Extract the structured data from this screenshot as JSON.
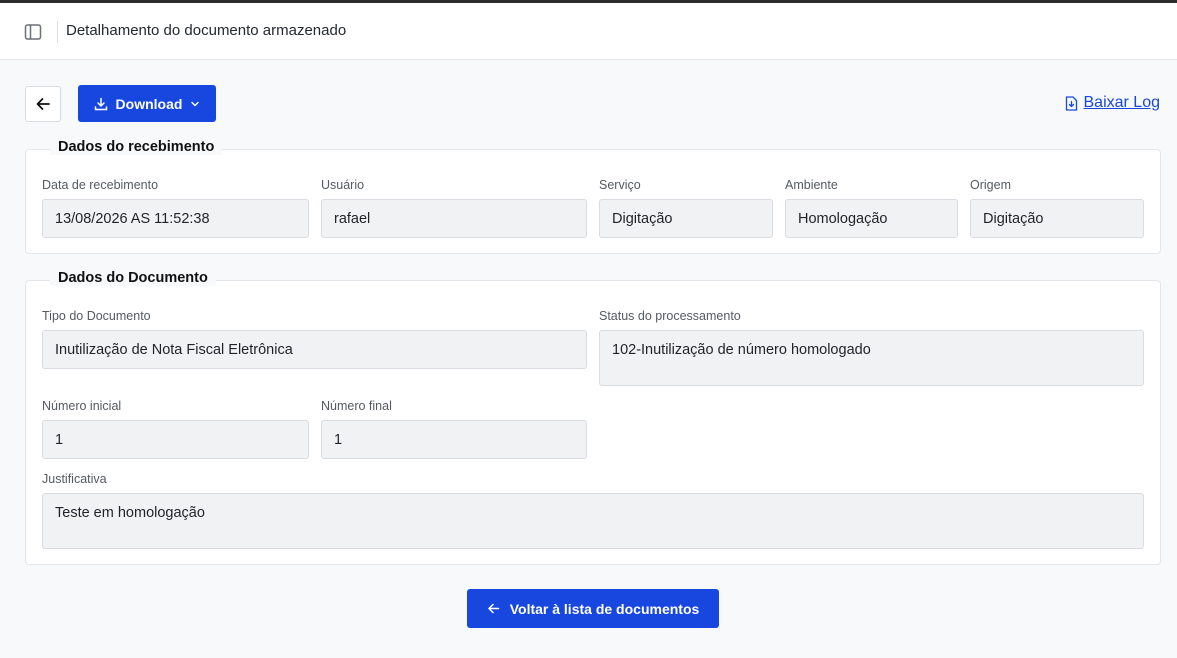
{
  "header": {
    "title": "Detalhamento do documento armazenado",
    "sidebar_toggle_icon": "sidebar-panel-icon"
  },
  "toolbar": {
    "back_icon": "arrow-left-icon",
    "download_label": "Download",
    "download_icon": "download-icon",
    "download_chevron": "chevron-down-icon",
    "log_label": "Baixar Log",
    "log_icon": "file-download-icon"
  },
  "recebimento": {
    "legend": "Dados do recebimento",
    "fields": {
      "data": {
        "label": "Data de recebimento",
        "value": "13/08/2026 AS 11:52:38"
      },
      "usuario": {
        "label": "Usuário",
        "value": "rafael"
      },
      "servico": {
        "label": "Serviço",
        "value": "Digitação"
      },
      "ambiente": {
        "label": "Ambiente",
        "value": "Homologação"
      },
      "origem": {
        "label": "Origem",
        "value": "Digitação"
      }
    }
  },
  "documento": {
    "legend": "Dados do Documento",
    "fields": {
      "tipo": {
        "label": "Tipo do Documento",
        "value": "Inutilização de Nota Fiscal Eletrônica"
      },
      "status": {
        "label": "Status do processamento",
        "value": "102-Inutilização de número homologado"
      },
      "numero_inicial": {
        "label": "Número inicial",
        "value": "1"
      },
      "numero_final": {
        "label": "Número final",
        "value": "1"
      },
      "justificativa": {
        "label": "Justificativa",
        "value": "Teste em homologação"
      }
    }
  },
  "footer": {
    "back_to_list_label": "Voltar à lista de documentos",
    "back_to_list_icon": "arrow-left-icon"
  },
  "colors": {
    "accent": "#1847e0",
    "field_bg": "#f1f2f4",
    "page_bg": "#f8f9fb"
  }
}
